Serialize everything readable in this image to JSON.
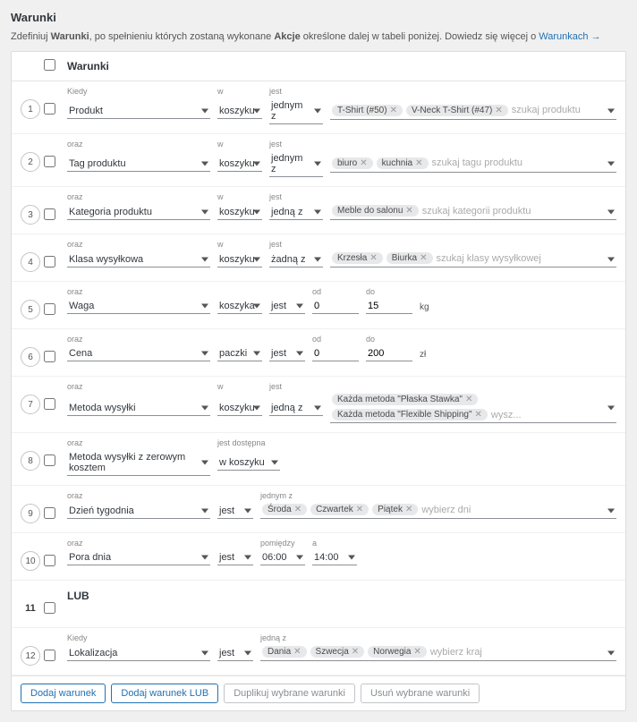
{
  "title": "Warunki",
  "desc_p1": "Zdefiniuj ",
  "desc_b1": "Warunki",
  "desc_p2": ", po spełnieniu których zostaną wykonane ",
  "desc_b2": "Akcje",
  "desc_p3": " określone dalej w tabeli poniżej. Dowiedz się więcej o ",
  "desc_link": "Warunkach →",
  "col_header": "Warunki",
  "labels": {
    "kiedy": "Kiedy",
    "oraz": "oraz",
    "w": "w",
    "jest": "jest",
    "jest_dost": "jest dostępna",
    "od": "od",
    "do": "do",
    "a": "a",
    "pomiedzy": "pomiędzy",
    "jednym_z": "jednym z",
    "jedna_z": "jedną z"
  },
  "rows": {
    "r1": {
      "num": "1",
      "what": "Produkt",
      "scope": "koszyku",
      "op": "jednym z",
      "tags": [
        "T-Shirt (#50)",
        "V-Neck T-Shirt (#47)"
      ],
      "ph": "szukaj produktu"
    },
    "r2": {
      "num": "2",
      "what": "Tag produktu",
      "scope": "koszyku",
      "op": "jednym z",
      "tags": [
        "biuro",
        "kuchnia"
      ],
      "ph": "szukaj tagu produktu"
    },
    "r3": {
      "num": "3",
      "what": "Kategoria produktu",
      "scope": "koszyku",
      "op": "jedną z",
      "tags": [
        "Meble do salonu"
      ],
      "ph": "szukaj kategorii produktu"
    },
    "r4": {
      "num": "4",
      "what": "Klasa wysyłkowa",
      "scope": "koszyku",
      "op": "żadną z",
      "tags": [
        "Krzesła",
        "Biurka"
      ],
      "ph": "szukaj klasy wysyłkowej"
    },
    "r5": {
      "num": "5",
      "what": "Waga",
      "scope": "koszyka",
      "op": "jest",
      "from": "0",
      "to": "15",
      "unit": "kg"
    },
    "r6": {
      "num": "6",
      "what": "Cena",
      "scope": "paczki",
      "op": "jest",
      "from": "0",
      "to": "200",
      "unit": "zł"
    },
    "r7": {
      "num": "7",
      "what": "Metoda wysyłki",
      "scope": "koszyku",
      "op": "jedną z",
      "tags": [
        "Każda metoda \"Płaska Stawka\"",
        "Każda metoda \"Flexible Shipping\""
      ],
      "ph": "wysz..."
    },
    "r8": {
      "num": "8",
      "what": "Metoda wysyłki z zerowym kosztem",
      "scope": "w koszyku"
    },
    "r9": {
      "num": "9",
      "what": "Dzień tygodnia",
      "op": "jest",
      "tags": [
        "Środa",
        "Czwartek",
        "Piątek"
      ],
      "ph": "wybierz dni"
    },
    "r10": {
      "num": "10",
      "what": "Pora dnia",
      "op": "jest",
      "from": "06:00",
      "to": "14:00"
    },
    "r11": {
      "num": "11",
      "label": "LUB"
    },
    "r12": {
      "num": "12",
      "what": "Lokalizacja",
      "op": "jest",
      "tags": [
        "Dania",
        "Szwecja",
        "Norwegia"
      ],
      "ph": "wybierz kraj"
    }
  },
  "footer": {
    "add": "Dodaj warunek",
    "add_or": "Dodaj warunek LUB",
    "dup": "Duplikuj wybrane warunki",
    "del": "Usuń wybrane warunki"
  }
}
